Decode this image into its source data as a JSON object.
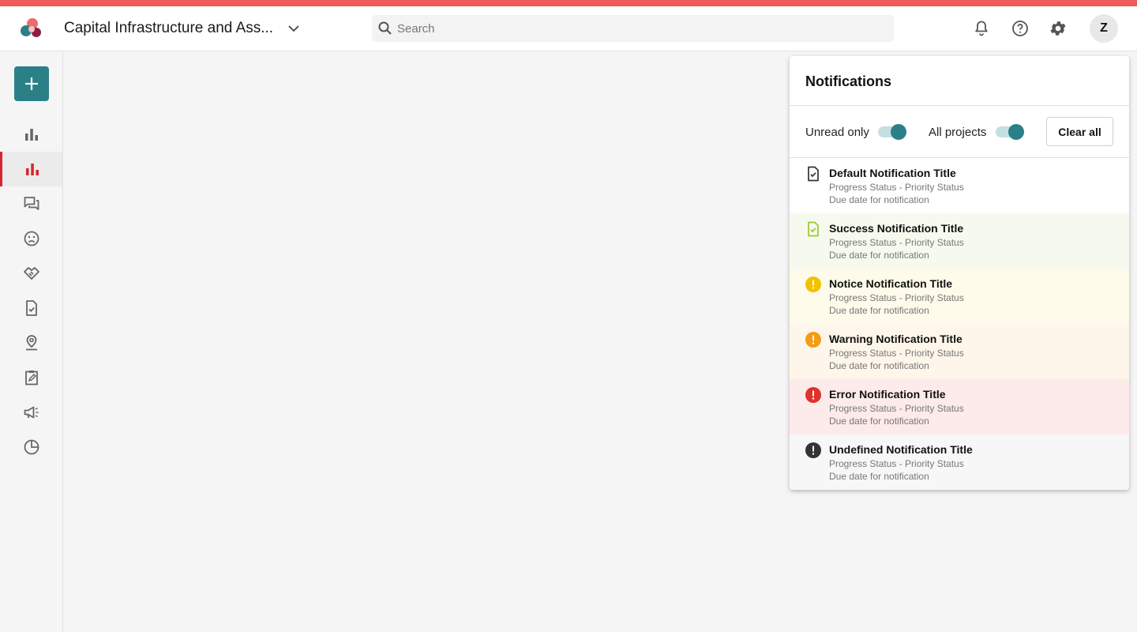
{
  "header": {
    "project_title": "Capital Infrastructure and Ass...",
    "search_placeholder": "Search",
    "avatar_initial": "Z",
    "icons": [
      "bell-icon",
      "help-icon",
      "gear-icon"
    ]
  },
  "colors": {
    "brand_strip": "#ef5b5b",
    "accent_teal": "#2b8088",
    "active_red": "#d6262f"
  },
  "sidebar": {
    "add_button_icon": "plus-icon",
    "items": [
      {
        "icon": "bar-chart-icon",
        "active": false
      },
      {
        "icon": "bar-chart-red-icon",
        "active": true
      },
      {
        "icon": "chat-icon",
        "active": false
      },
      {
        "icon": "sad-face-icon",
        "active": false
      },
      {
        "icon": "handshake-icon",
        "active": false
      },
      {
        "icon": "document-check-icon",
        "active": false
      },
      {
        "icon": "location-pin-icon",
        "active": false
      },
      {
        "icon": "clipboard-edit-icon",
        "active": false
      },
      {
        "icon": "megaphone-icon",
        "active": false
      },
      {
        "icon": "pie-chart-icon",
        "active": false
      }
    ]
  },
  "notifications": {
    "title": "Notifications",
    "filters": {
      "unread_label": "Unread only",
      "unread_on": true,
      "all_projects_label": "All projects",
      "all_projects_on": true,
      "clear_label": "Clear all"
    },
    "items": [
      {
        "kind": "default",
        "icon": "document-check-icon",
        "title": "Default Notification Title",
        "status": "Progress Status - Priority Status",
        "due": "Due date for notification",
        "bg": "#ffffff",
        "color": "#333333"
      },
      {
        "kind": "success",
        "icon": "document-check-icon",
        "title": "Success Notification Title",
        "status": "Progress Status - Priority Status",
        "due": "Due date for notification",
        "bg": "#f6faee",
        "color": "#9cc72d"
      },
      {
        "kind": "notice",
        "icon": "alert-circle-icon",
        "title": "Notice Notification Title",
        "status": "Progress Status - Priority Status",
        "due": "Due date for notification",
        "bg": "#fefbea",
        "color": "#f2c200"
      },
      {
        "kind": "warning",
        "icon": "alert-circle-icon",
        "title": "Warning Notification Title",
        "status": "Progress Status - Priority Status",
        "due": "Due date for notification",
        "bg": "#fef6ea",
        "color": "#f59b16"
      },
      {
        "kind": "error",
        "icon": "alert-circle-icon",
        "title": "Error Notification Title",
        "status": "Progress Status - Priority Status",
        "due": "Due date for notification",
        "bg": "#fdeaea",
        "color": "#e0322b"
      },
      {
        "kind": "undefined",
        "icon": "alert-circle-icon",
        "title": "Undefined Notification Title",
        "status": "Progress Status - Priority Status",
        "due": "Due date for notification",
        "bg": "#f7f7f7",
        "color": "#333333"
      }
    ]
  }
}
